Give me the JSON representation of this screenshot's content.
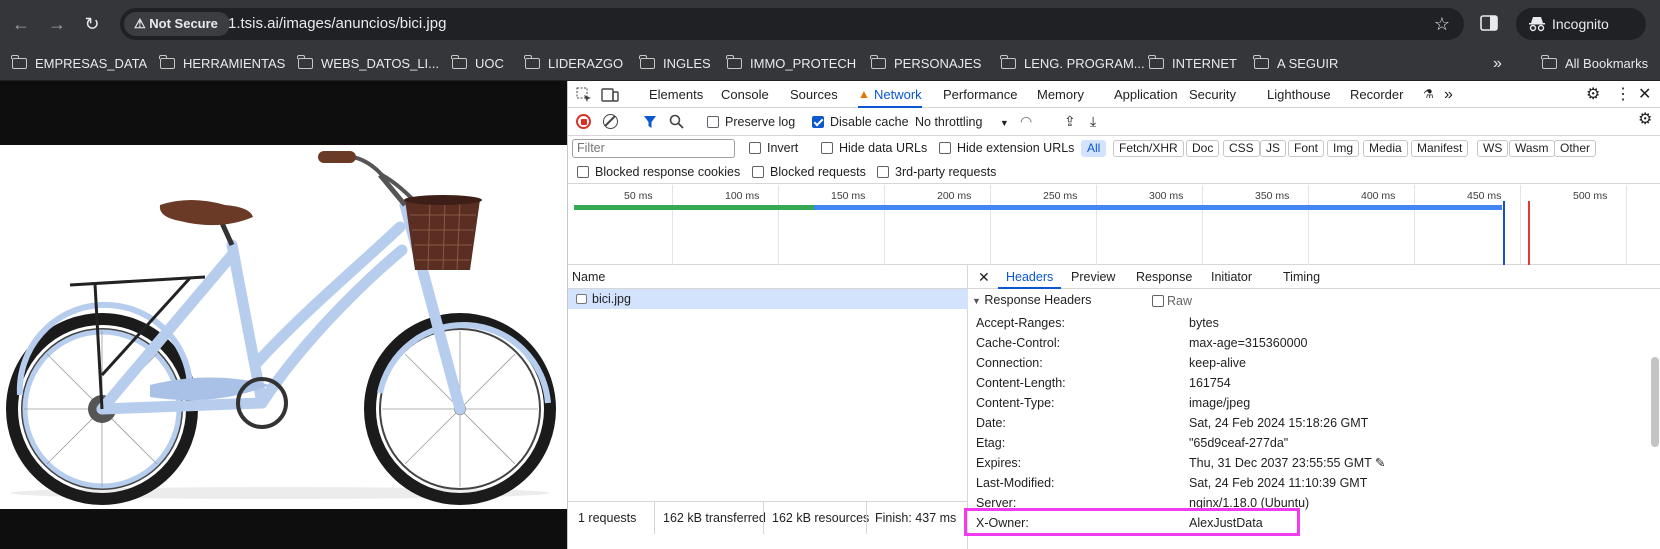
{
  "browser": {
    "security_label": "Not Secure",
    "url": "1.tsis.ai/images/anuncios/bici.jpg",
    "incognito_label": "Incognito",
    "bookmarks": [
      "EMPRESAS_DATA",
      "HERRAMIENTAS",
      "WEBS_DATOS_LI...",
      "UOC",
      "LIDERAZGO",
      "INGLES",
      "IMMO_PROTECH",
      "PERSONAJES",
      "LENG. PROGRAM...",
      "INTERNET",
      "A SEGUIR"
    ],
    "all_bookmarks": "All Bookmarks",
    "overflow": "»"
  },
  "devtools": {
    "tabs": [
      "Elements",
      "Console",
      "Sources",
      "Network",
      "Performance",
      "Memory",
      "Application",
      "Security",
      "Lighthouse",
      "Recorder"
    ],
    "active_tab": "Network",
    "toolbar": {
      "preserve_log": "Preserve log",
      "disable_cache": "Disable cache",
      "throttling": "No throttling"
    },
    "filter": {
      "placeholder": "Filter",
      "invert": "Invert",
      "hide_data_urls": "Hide data URLs",
      "hide_extension_urls": "Hide extension URLs",
      "types": [
        "All",
        "Fetch/XHR",
        "Doc",
        "CSS",
        "JS",
        "Font",
        "Img",
        "Media",
        "Manifest",
        "WS",
        "Wasm",
        "Other"
      ],
      "blocked_cookies": "Blocked response cookies",
      "blocked_requests": "Blocked requests",
      "third_party": "3rd-party requests"
    },
    "overview": {
      "ticks": [
        "50 ms",
        "100 ms",
        "150 ms",
        "200 ms",
        "250 ms",
        "300 ms",
        "350 ms",
        "400 ms",
        "450 ms",
        "500 ms"
      ]
    },
    "requests": {
      "column": "Name",
      "rows": [
        "bici.jpg"
      ]
    },
    "status": {
      "requests": "1 requests",
      "transferred": "162 kB transferred",
      "resources": "162 kB resources",
      "finish": "Finish: 437 ms"
    },
    "detail": {
      "tabs": [
        "Headers",
        "Preview",
        "Response",
        "Initiator",
        "Timing"
      ],
      "section": "Response Headers",
      "raw": "Raw",
      "headers": [
        {
          "key": "Accept-Ranges:",
          "value": "bytes"
        },
        {
          "key": "Cache-Control:",
          "value": "max-age=315360000"
        },
        {
          "key": "Connection:",
          "value": "keep-alive"
        },
        {
          "key": "Content-Length:",
          "value": "161754"
        },
        {
          "key": "Content-Type:",
          "value": "image/jpeg"
        },
        {
          "key": "Date:",
          "value": "Sat, 24 Feb 2024 15:18:26 GMT"
        },
        {
          "key": "Etag:",
          "value": "\"65d9ceaf-277da\""
        },
        {
          "key": "Expires:",
          "value": "Thu, 31 Dec 2037 23:55:55 GMT"
        },
        {
          "key": "Last-Modified:",
          "value": "Sat, 24 Feb 2024 11:10:39 GMT"
        },
        {
          "key": "Server:",
          "value": "nginx/1.18.0 (Ubuntu)"
        },
        {
          "key": "X-Owner:",
          "value": "AlexJustData"
        }
      ]
    }
  },
  "colors": {
    "accent": "#0b57d0",
    "highlight": "#f13bf1",
    "bike_frame": "#b7cdee"
  }
}
